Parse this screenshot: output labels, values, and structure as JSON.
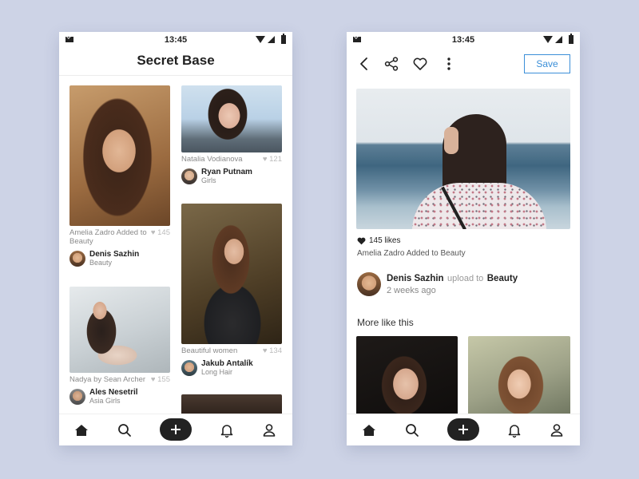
{
  "status": {
    "time_left": "13:45",
    "time_right": "13:45"
  },
  "feed": {
    "title": "Secret Base",
    "cards": [
      {
        "caption": "Amelia Zadro Added to  Beauty",
        "likes": "145",
        "user": "Denis Sazhin",
        "board": "Beauty"
      },
      {
        "caption": "Natalia Vodianova",
        "likes": "121",
        "user": "Ryan Putnam",
        "board": "Girls"
      },
      {
        "caption": "Beautiful women",
        "likes": "134",
        "user": "Jakub Antalík",
        "board": "Long Hair"
      },
      {
        "caption": "Nadya by Sean Archer",
        "likes": "155",
        "user": "Ales Nesetril",
        "board": "Asia Girls"
      }
    ]
  },
  "detail": {
    "save_label": "Save",
    "likes_text": "145 likes",
    "added_text": "Amelia Zadro Added to  Beauty",
    "uploader_name": "Denis Sazhin",
    "uploader_mid": "upload to",
    "uploader_board": "Beauty",
    "uploader_time": "2 weeks ago",
    "more_title": "More like this"
  },
  "icons": {
    "tabbar": [
      "home-icon",
      "search-icon",
      "add-icon",
      "bell-icon",
      "profile-icon"
    ],
    "topbar": [
      "back-icon",
      "share-icon",
      "heart-icon",
      "more-vertical-icon"
    ]
  },
  "colors": {
    "background": "#cdd3e6",
    "accent": "#3b8fd8",
    "text": "#222222"
  }
}
